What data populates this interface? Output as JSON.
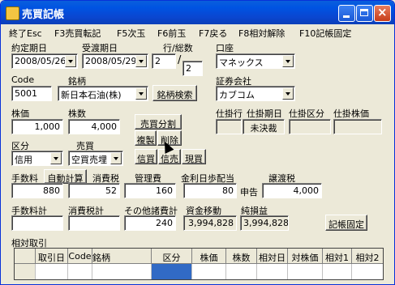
{
  "window": {
    "title": "売買記帳"
  },
  "menu": [
    "終了Esc",
    "F3売買転記",
    "F5次玉",
    "F6前玉",
    "F7戻る",
    "F8相対解除",
    "F10記帳固定"
  ],
  "form": {
    "yakujo_label": "約定期日",
    "yakujo_value": "2008/05/26",
    "ukewatashi_label": "受渡期日",
    "ukewatashi_value": "2008/05/29",
    "gyo_label": "行/総数",
    "gyo_value": "2",
    "sosu_value": "2",
    "koza_label": "口座",
    "koza_value": "マネックス",
    "code_label": "Code",
    "code_value": "5001",
    "meigara_label": "銘柄",
    "meigara_value": "新日本石油(株)",
    "meigara_search": "銘柄検索",
    "shoken_label": "証券会社",
    "shoken_value": "カブコム",
    "kabuka_label": "株価",
    "kabuka_value": "1,000",
    "kabusu_label": "株数",
    "kabusu_value": "4,000",
    "baibai_bunkatsu": "売買分割",
    "fukusei": "複製",
    "sakujo": "削除",
    "shikake_gyo_label": "仕掛行",
    "shikake_kijitsu_label": "仕掛期日",
    "shikake_kubun_label": "仕掛区分",
    "shikake_kabuka_label": "仕掛株価",
    "shikake_kijitsu_value": "未決裁",
    "kubun_label": "区分",
    "kubun_value": "信用",
    "baibai_label": "売買",
    "baibai_value": "空買売埋",
    "shingai": "信買",
    "shinbai": "信売",
    "genbai": "現買",
    "tesuryo_label": "手数料",
    "jido_keisan": "自動計算",
    "shohizei_label": "消費税",
    "kanrihi_label": "管理費",
    "kinri_label": "金利日歩配当",
    "joto_label": "譲渡税",
    "tesuryo_value": "880",
    "shohizei_value": "52",
    "kanrihi_value": "160",
    "kinri_value": "80",
    "shinkoku": "申告",
    "joto_value": "4,000",
    "tesuryokei_label": "手数料計",
    "shohizeikei_label": "消費税計",
    "sonota_label": "その他諸費計",
    "shikin_label": "資金移動",
    "junsoneki_label": "純損益",
    "sonota_value": "240",
    "shikin_value": "3,994,828",
    "junsoneki_value": "3,994,828",
    "kicho_kotei": "記帳固定",
    "sotai_label": "相対取引"
  },
  "grid_headers": [
    "",
    "取引日",
    "Code",
    "銘柄",
    "区分",
    "株価",
    "株数",
    "相対日",
    "対株価",
    "相対1",
    "相対2"
  ]
}
